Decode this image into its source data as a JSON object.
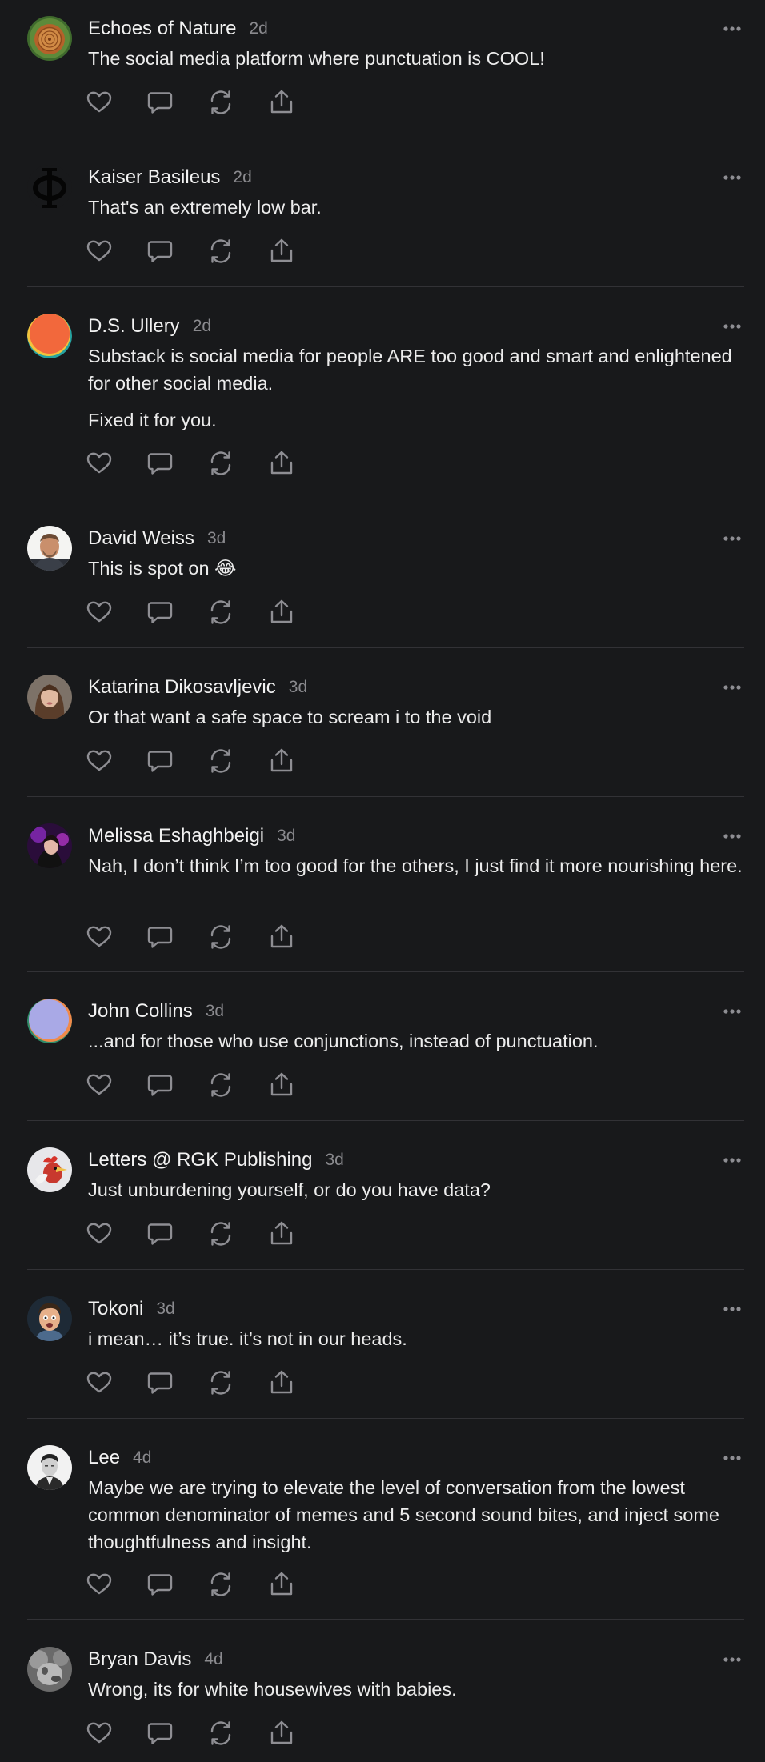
{
  "colors": {
    "background": "#18191b",
    "text": "#ececec",
    "muted": "#8a8a8e",
    "icon": "#8e8e93",
    "divider": "#323236"
  },
  "comments": [
    {
      "author": "Echoes of Nature",
      "time": "2d",
      "avatar": "tree-rings",
      "paragraphs": [
        "The social media platform where punctuation is COOL!"
      ]
    },
    {
      "author": "Kaiser Basileus",
      "time": "2d",
      "avatar": "phi-symbol",
      "paragraphs": [
        "That's an extremely low bar."
      ]
    },
    {
      "author": "D.S. Ullery",
      "time": "2d",
      "avatar": "orange-gradient",
      "paragraphs": [
        "Substack is social media for people ARE too good and smart and enlightened for other social media.",
        "Fixed it for you."
      ]
    },
    {
      "author": "David Weiss",
      "time": "3d",
      "avatar": "photo-man",
      "paragraphs": [
        "This is spot on 😂"
      ]
    },
    {
      "author": "Katarina Dikosavljevic",
      "time": "3d",
      "avatar": "photo-woman",
      "paragraphs": [
        "Or that want a safe space to scream i to the void"
      ]
    },
    {
      "author": "Melissa Eshaghbeigi",
      "time": "3d",
      "avatar": "photo-purple",
      "paragraphs": [
        "Nah, I don’t think I’m too good for the others, I just find it more nourishing here."
      ]
    },
    {
      "author": "John Collins",
      "time": "3d",
      "avatar": "lavender-gradient",
      "paragraphs": [
        "...and for those who use conjunctions, instead of punctuation."
      ]
    },
    {
      "author": "Letters @ RGK Publishing",
      "time": "3d",
      "avatar": "rooster",
      "paragraphs": [
        "Just unburdening yourself, or do you have data?"
      ]
    },
    {
      "author": "Tokoni",
      "time": "3d",
      "avatar": "cartoon-face",
      "paragraphs": [
        "i mean… it’s true. it’s not in our heads."
      ]
    },
    {
      "author": "Lee",
      "time": "4d",
      "avatar": "photo-bw",
      "paragraphs": [
        "Maybe we are trying to elevate the level of conversation from the lowest common denominator of memes and 5 second sound bites, and inject some thoughtfulness and insight."
      ]
    },
    {
      "author": "Bryan Davis",
      "time": "4d",
      "avatar": "photo-gray",
      "paragraphs": [
        "Wrong, its for white housewives with babies."
      ]
    }
  ],
  "icons": {
    "like": "heart-icon",
    "reply": "speech-bubble-icon",
    "restack": "restack-icon",
    "share": "share-icon",
    "more": "more-dots-icon"
  }
}
